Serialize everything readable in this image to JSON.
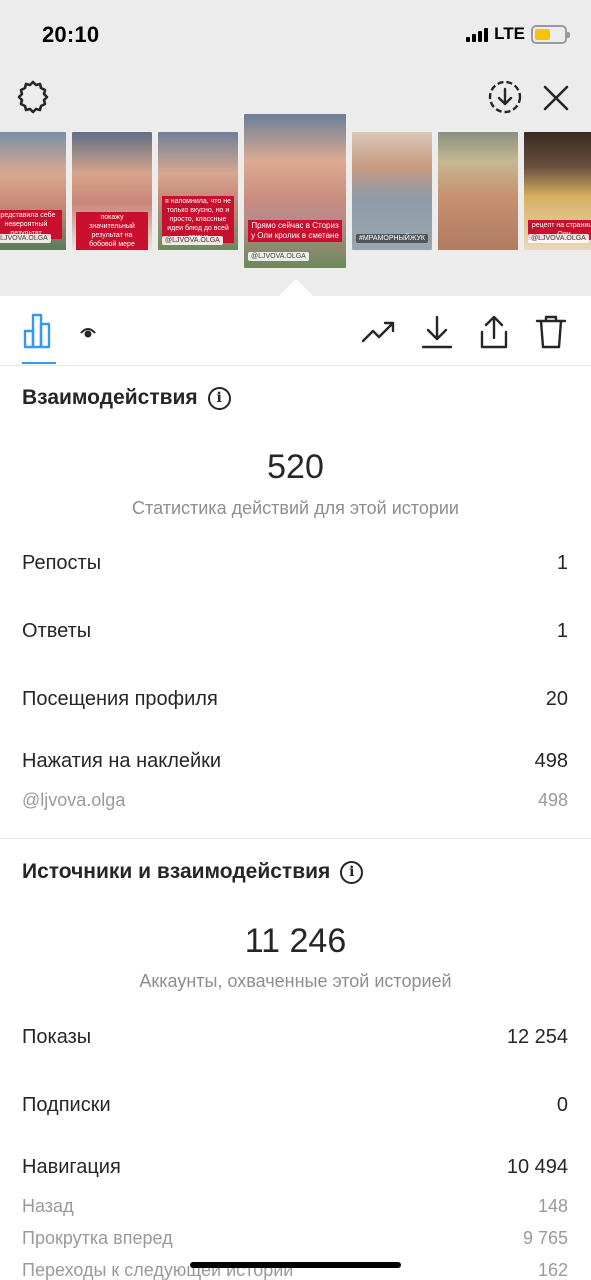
{
  "status_bar": {
    "time": "20:10",
    "network": "LTE",
    "battery_color": "#f6c500"
  },
  "header": {
    "settings_icon": "gear-icon",
    "save_icon": "download-circle-icon",
    "close_icon": "close-icon"
  },
  "stories": [
    {
      "caption": "представила себе невероятный результат",
      "tag": "@LJVOVA.OLGA"
    },
    {
      "caption": "покажу значительный результат на бобовой мере",
      "tag": ""
    },
    {
      "caption": "я напомнила, что не только вкусно, но и просто, классные идеи блюд до всей семьи",
      "tag": "@LJVOVA.OLGA"
    },
    {
      "caption": "Прямо сейчас в Сториз у Оли кролик в сметане",
      "tag": "@LJVOVA.OLGA"
    },
    {
      "caption": "",
      "tag": "#МРАМОРНЫЙЖУК"
    },
    {
      "caption": "",
      "tag": ""
    },
    {
      "caption": "рецепт на странице Оли",
      "tag": "@LJVOVA.OLGA"
    }
  ],
  "toolbar": {
    "stats_icon": "bar-chart-icon",
    "views_icon": "eye-icon",
    "promote_icon": "trending-up-icon",
    "download_icon": "download-icon",
    "share_icon": "share-icon",
    "delete_icon": "trash-icon",
    "accent_color": "#3897f0"
  },
  "interactions": {
    "title": "Взаимодействия",
    "total": "520",
    "subtitle": "Статистика действий для этой истории",
    "rows": [
      {
        "label": "Репосты",
        "value": "1"
      },
      {
        "label": "Ответы",
        "value": "1"
      },
      {
        "label": "Посещения профиля",
        "value": "20"
      },
      {
        "label": "Нажатия на наклейки",
        "value": "498"
      }
    ],
    "sub_rows": [
      {
        "label": "@ljvova.olga",
        "value": "498"
      }
    ]
  },
  "discovery": {
    "title": "Источники и взаимодействия",
    "total": "11 246",
    "subtitle": "Аккаунты, охваченные этой историей",
    "rows": [
      {
        "label": "Показы",
        "value": "12 254"
      },
      {
        "label": "Подписки",
        "value": "0"
      },
      {
        "label": "Навигация",
        "value": "10 494"
      }
    ],
    "sub_rows": [
      {
        "label": "Назад",
        "value": "148"
      },
      {
        "label": "Прокрутка вперед",
        "value": "9 765"
      },
      {
        "label": "Переходы к следующей истории",
        "value": "162"
      }
    ]
  }
}
